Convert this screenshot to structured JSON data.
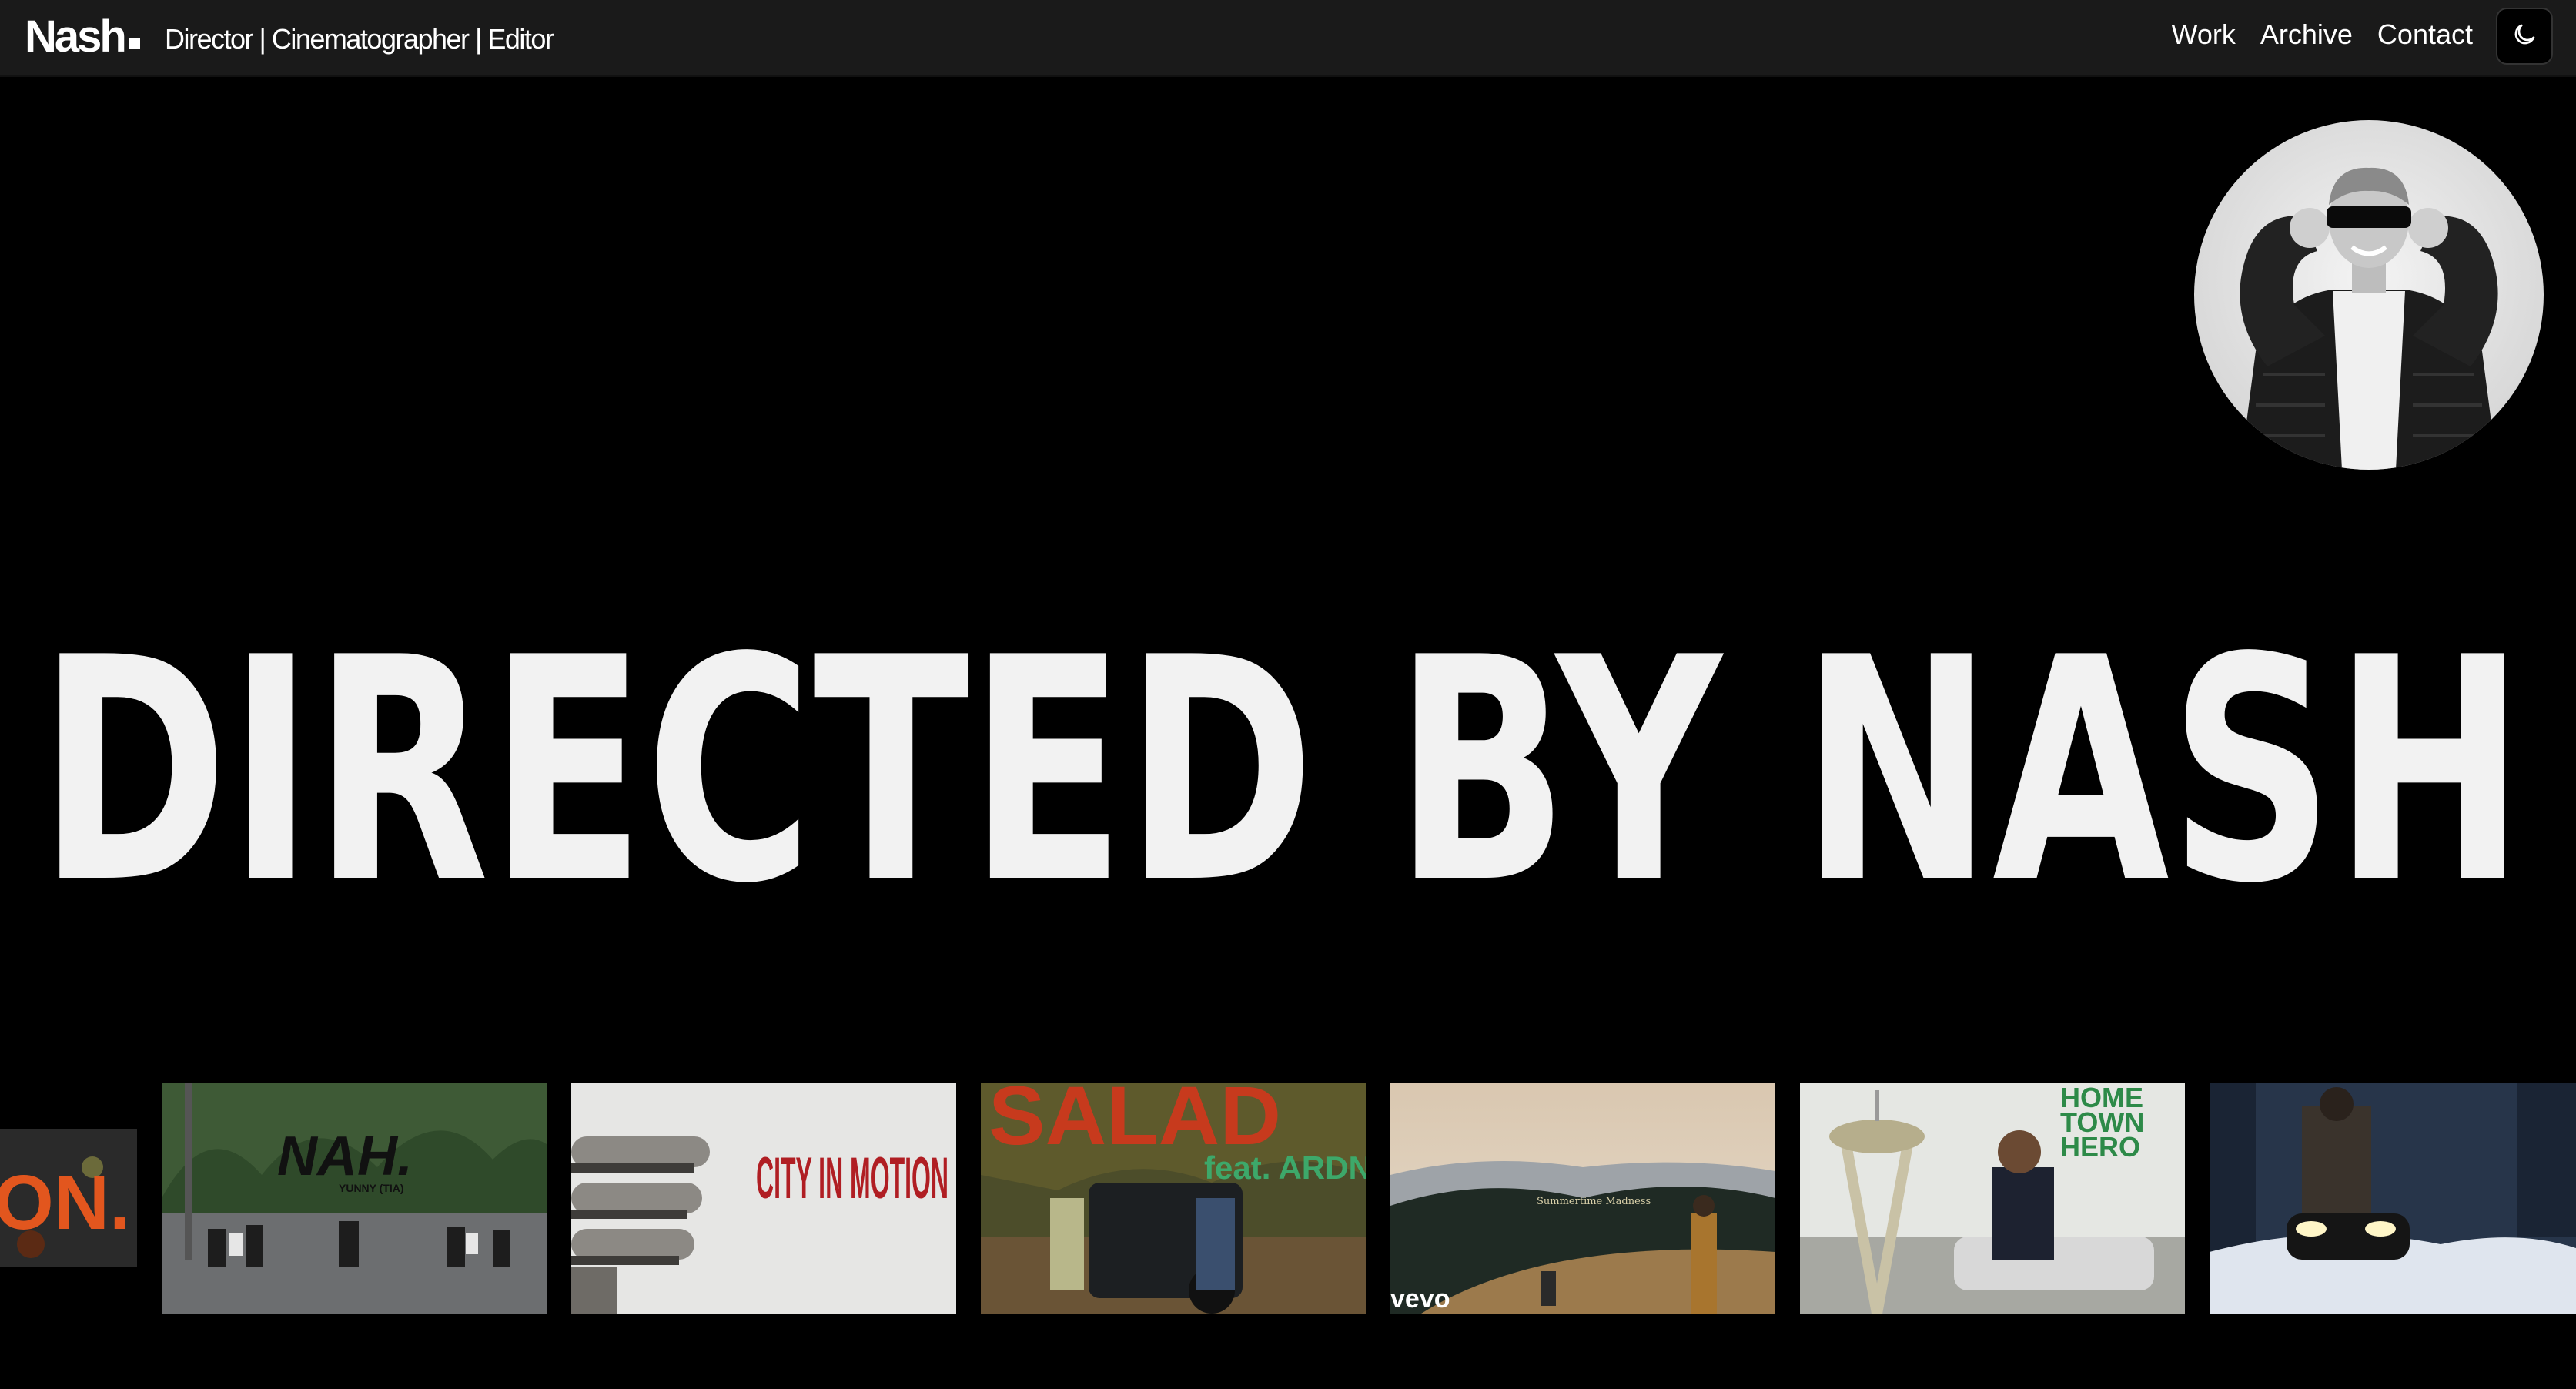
{
  "header": {
    "brand": "Nash",
    "tagline": "Director | Cinematographer | Editor",
    "nav": [
      "Work",
      "Archive",
      "Contact"
    ],
    "theme_toggle_icon": "moon-icon"
  },
  "hero": {
    "title": "DIRECTED BY NASH"
  },
  "gallery": [
    {
      "text": "ON."
    },
    {
      "text": "NAH.",
      "subtext": "YUNNY (TIA)"
    },
    {
      "text": "CITY IN MOTION"
    },
    {
      "text": "SALAD",
      "subtext": "feat. ARDN"
    },
    {
      "text": "Summertime Madness",
      "subtext": "vevo"
    },
    {
      "text": "HOME TOWN HERO"
    },
    {
      "text": ""
    }
  ]
}
